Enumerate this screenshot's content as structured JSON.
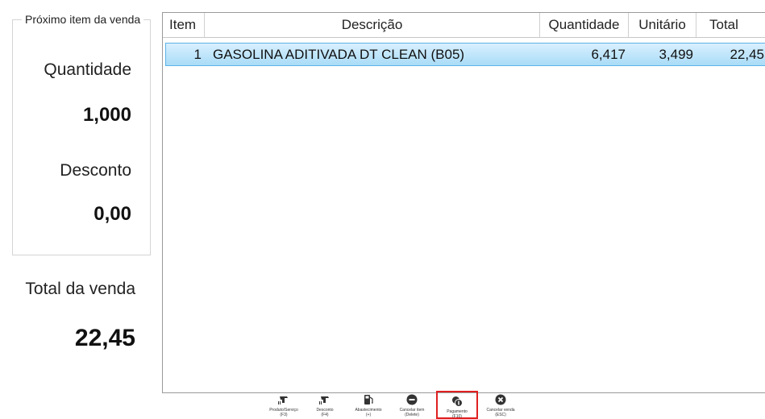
{
  "next_item": {
    "title": "Próximo item da venda",
    "quantity_label": "Quantidade",
    "quantity_value": "1,000",
    "discount_label": "Desconto",
    "discount_value": "0,00"
  },
  "sale_total": {
    "label": "Total da venda",
    "value": "22,45"
  },
  "grid": {
    "columns": [
      "Item",
      "Descrição",
      "Quantidade",
      "Unitário",
      "Total"
    ],
    "rows": [
      {
        "item": "1",
        "description": "GASOLINA ADITIVADA DT CLEAN (B05)",
        "quantity": "6,417",
        "unit": "3,499",
        "total": "22,45"
      }
    ]
  },
  "toolbar": {
    "buttons": [
      {
        "label": "Produto/Serviço",
        "key": "(F3)",
        "icon": "barcode-scanner-icon"
      },
      {
        "label": "Desconto",
        "key": "(F4)",
        "icon": "barcode-scanner-icon"
      },
      {
        "label": "Abastecimento",
        "key": "(+)",
        "icon": "fuel-pump-icon"
      },
      {
        "label": "Cancelar item",
        "key": "(Delete)",
        "icon": "minus-circle-icon"
      },
      {
        "label": "Pagamento",
        "key": "(F10)",
        "icon": "money-icon"
      },
      {
        "label": "Cancelar venda",
        "key": "(ESC)",
        "icon": "close-circle-icon"
      }
    ]
  },
  "colors": {
    "selected_row_top": "#d9f0ff",
    "selected_row_bottom": "#a9dcf7",
    "selected_button_border": "#e02020"
  }
}
